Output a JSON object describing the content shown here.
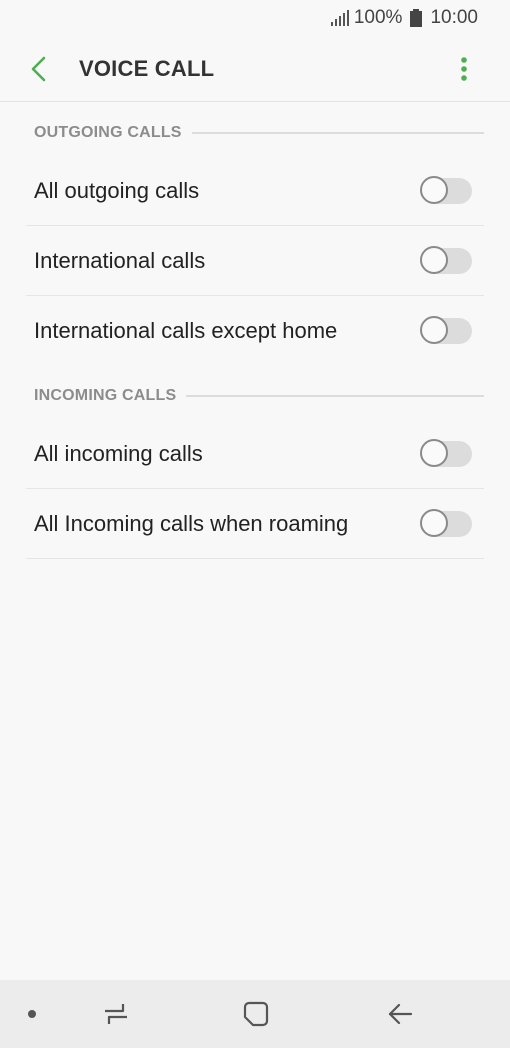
{
  "status_bar": {
    "battery": "100%",
    "time": "10:00",
    "signal_icon": "signal-icon",
    "battery_icon": "battery-icon"
  },
  "app_bar": {
    "title": "VOICE CALL",
    "back_icon": "chevron-left-icon",
    "more_icon": "more-vert-icon",
    "accent_color": "#4caf50"
  },
  "sections": [
    {
      "title": "OUTGOING CALLS",
      "items": [
        {
          "label": "All outgoing calls",
          "enabled": false
        },
        {
          "label": "International calls",
          "enabled": false
        },
        {
          "label": "International calls except home",
          "enabled": false
        }
      ]
    },
    {
      "title": "INCOMING CALLS",
      "items": [
        {
          "label": "All incoming calls",
          "enabled": false
        },
        {
          "label": "All Incoming calls when roaming",
          "enabled": false
        }
      ]
    }
  ],
  "nav_bar": {
    "items": [
      "dot-icon",
      "recent-apps-icon",
      "home-icon",
      "back-icon"
    ]
  }
}
